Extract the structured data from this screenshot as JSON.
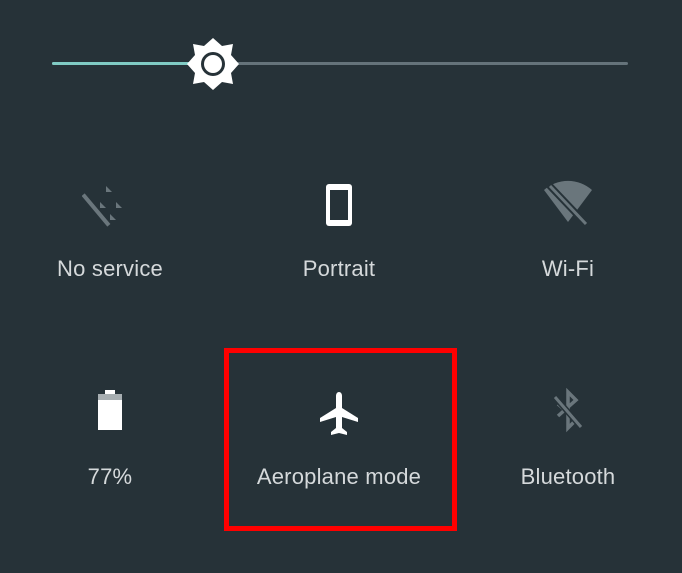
{
  "brightness": {
    "level": 0.28,
    "icon": "brightness-icon",
    "track_color": "#65737a",
    "fill_color": "#80cbc4"
  },
  "tiles": [
    {
      "label": "No service",
      "icon": "no-signal-icon",
      "state": "disabled"
    },
    {
      "label": "Portrait",
      "icon": "phone-portrait-icon",
      "state": "enabled"
    },
    {
      "label": "Wi-Fi",
      "icon": "wifi-off-icon",
      "state": "disabled"
    },
    {
      "label": "77%",
      "icon": "battery-icon",
      "state": "enabled"
    },
    {
      "label": "Aeroplane mode",
      "icon": "airplane-icon",
      "state": "enabled",
      "highlighted": true
    },
    {
      "label": "Bluetooth",
      "icon": "bluetooth-off-icon",
      "state": "disabled"
    }
  ],
  "colors": {
    "background": "#263238",
    "icon_active": "#ffffff",
    "icon_inactive": "#6a767c",
    "label": "#d5d9db",
    "highlight": "#ff0000"
  }
}
